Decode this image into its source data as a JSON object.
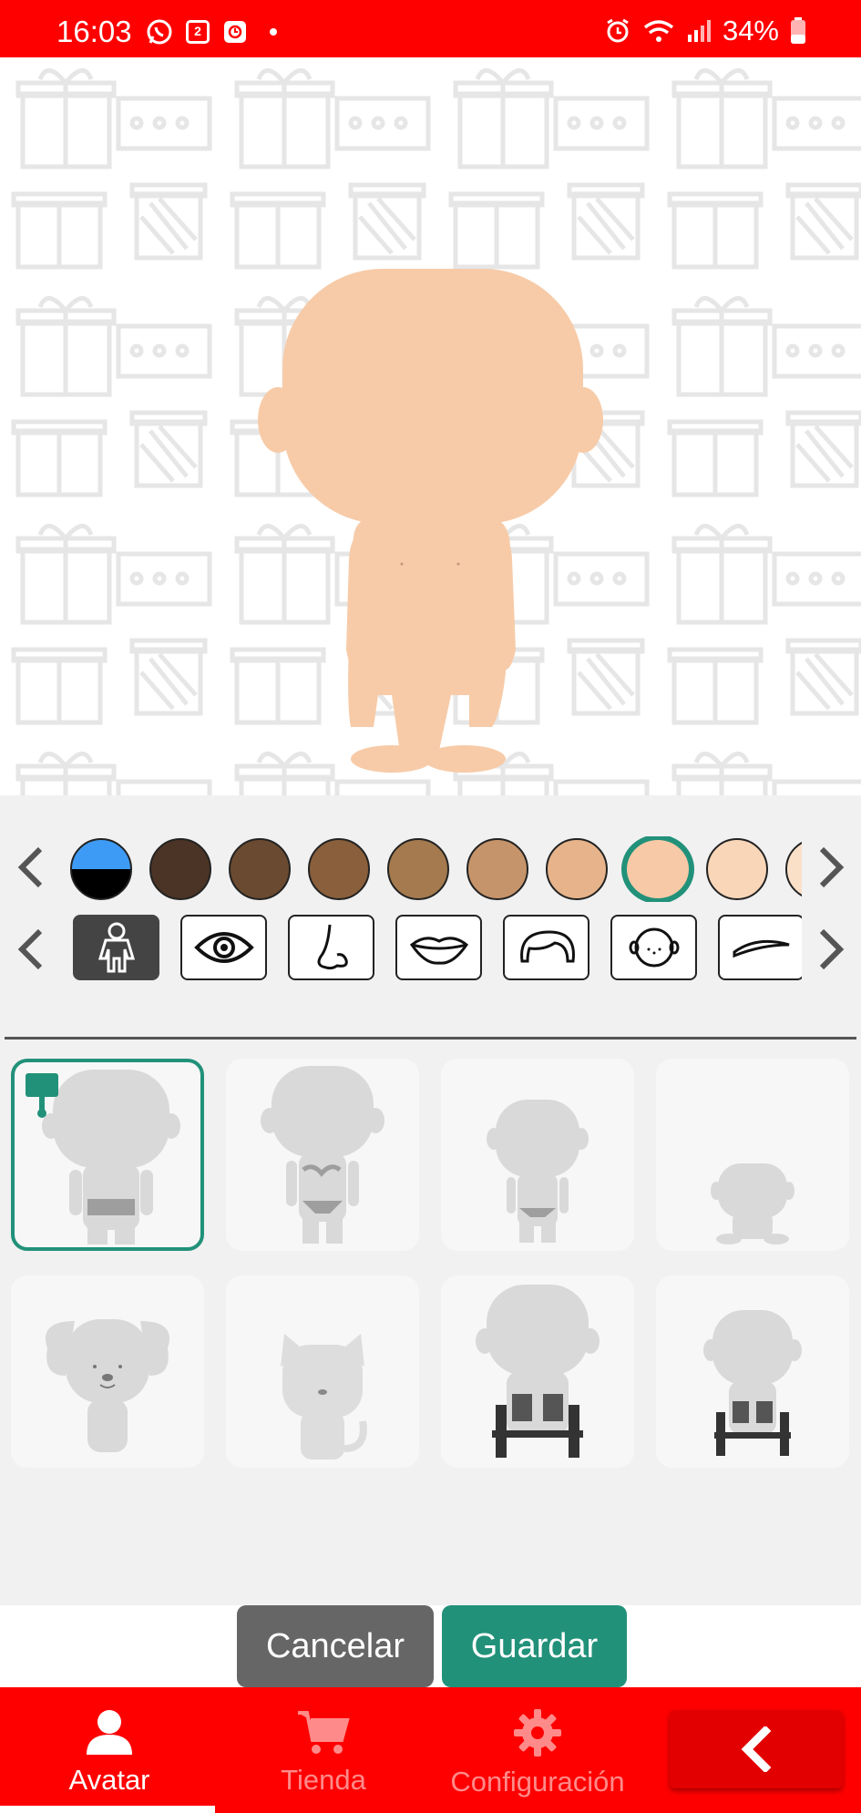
{
  "status_bar": {
    "time": "16:03",
    "calendar_day": "2",
    "battery": "34%"
  },
  "skin_colors": [
    "#3e9bf5",
    "#4b3425",
    "#6a4a30",
    "#8a5f3b",
    "#a47a4e",
    "#c6946a",
    "#e6b38a",
    "#f7c9a6",
    "#f9d6b8",
    "#fbe0c8"
  ],
  "selected_skin_index": 7,
  "part_categories": [
    "body-icon",
    "eye-icon",
    "nose-icon",
    "lips-icon",
    "hair-icon",
    "face-icon",
    "eyebrow-icon"
  ],
  "selected_part_index": 0,
  "body_options": [
    "body-boy",
    "body-girl",
    "body-child",
    "body-baby",
    "body-dog",
    "body-cat",
    "body-wheelchair-adult",
    "body-wheelchair-child"
  ],
  "selected_body_index": 0,
  "actions": {
    "cancel_label": "Cancelar",
    "save_label": "Guardar"
  },
  "nav": {
    "avatar_label": "Avatar",
    "store_label": "Tienda",
    "settings_label": "Configuración"
  },
  "colors": {
    "accent": "#22917a",
    "brand": "#ff0000",
    "skin": "#f7c9a6"
  }
}
